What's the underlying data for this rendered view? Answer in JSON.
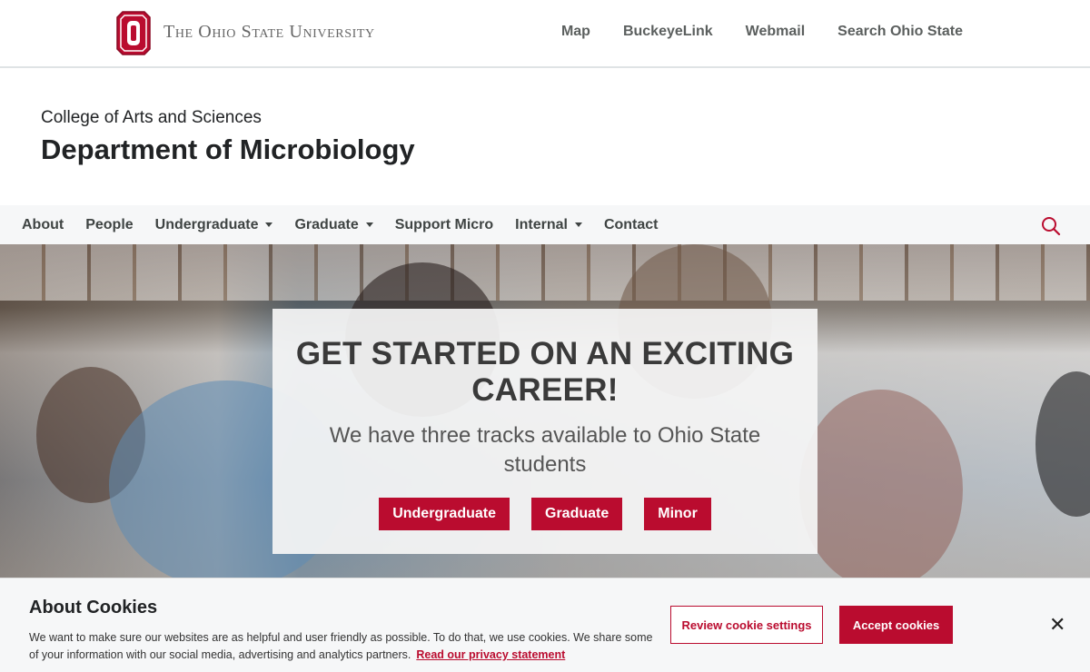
{
  "osu_header": {
    "wordmark": "The Ohio State University",
    "links": [
      "Map",
      "BuckeyeLink",
      "Webmail",
      "Search Ohio State"
    ],
    "logo_icon": "block-o-logo-icon"
  },
  "site_header": {
    "college": "College of Arts and Sciences",
    "department": "Department of Microbiology"
  },
  "main_nav": {
    "items": [
      {
        "label": "About",
        "dropdown": false
      },
      {
        "label": "People",
        "dropdown": false
      },
      {
        "label": "Undergraduate",
        "dropdown": true
      },
      {
        "label": "Graduate",
        "dropdown": true
      },
      {
        "label": "Support Micro",
        "dropdown": false
      },
      {
        "label": "Internal",
        "dropdown": true
      },
      {
        "label": "Contact",
        "dropdown": false
      }
    ],
    "search_icon": "search-icon"
  },
  "hero": {
    "title": "GET STARTED ON AN EXCITING CAREER!",
    "subtitle": "We have three tracks available to Ohio State students",
    "buttons": [
      "Undergraduate",
      "Graduate",
      "Minor"
    ]
  },
  "cookie_banner": {
    "title": "About Cookies",
    "text": "We want to make sure our websites are as helpful and user friendly as possible. To do that, we use cookies. We share some of your information with our social media, advertising and analytics partners.",
    "privacy_link": "Read our privacy statement",
    "review_button": "Review cookie settings",
    "accept_button": "Accept cookies",
    "close_icon": "close-icon"
  },
  "colors": {
    "scarlet": "#ba0c2f",
    "gray_text": "#3f4443",
    "nav_bg": "#f6f7f8"
  }
}
